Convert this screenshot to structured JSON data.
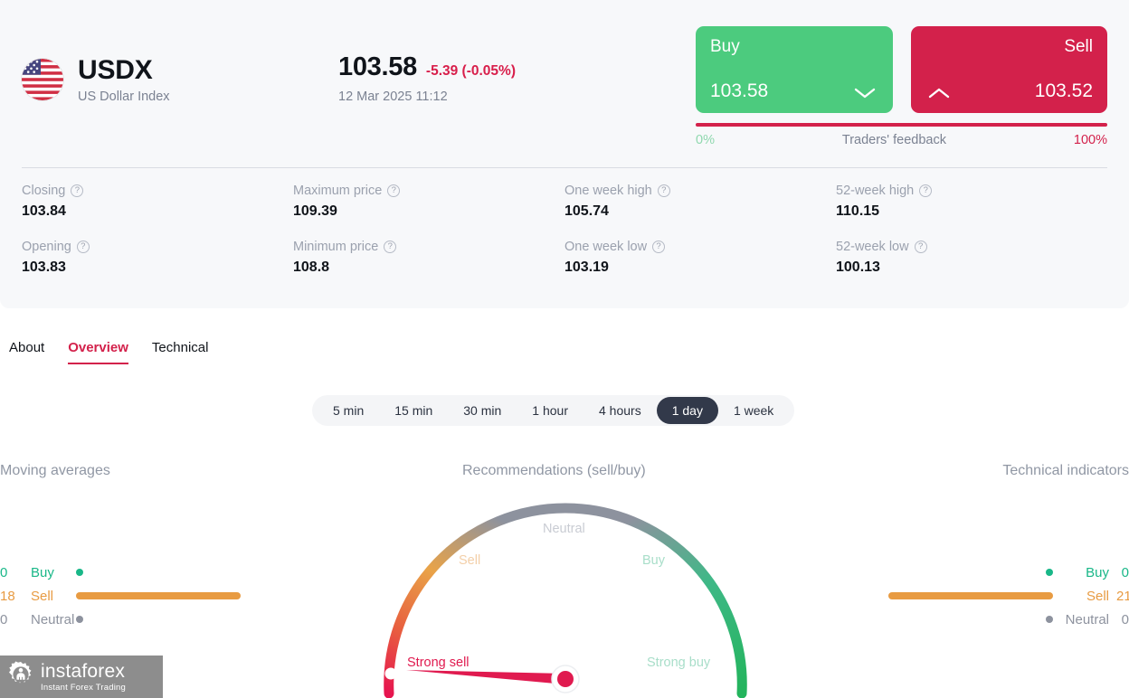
{
  "symbol": {
    "ticker": "USDX",
    "name": "US Dollar Index",
    "flag_icon": "us-flag-icon"
  },
  "quote": {
    "price": "103.58",
    "change": "-5.39 (-0.05%)",
    "timestamp": "12 Mar 2025 11:12",
    "change_color": "#d81e4a"
  },
  "trade": {
    "buy_label": "Buy",
    "buy_price": "103.58",
    "buy_color": "#4ccb7e",
    "sell_label": "Sell",
    "sell_price": "103.52",
    "sell_color": "#d3214b",
    "feedback_label": "Traders' feedback",
    "feedback_buy_pct": "0%",
    "feedback_sell_pct": "100%"
  },
  "stats": [
    {
      "label": "Closing",
      "value": "103.84"
    },
    {
      "label": "Maximum price",
      "value": "109.39"
    },
    {
      "label": "One week high",
      "value": "105.74"
    },
    {
      "label": "52-week high",
      "value": "110.15"
    },
    {
      "label": "Opening",
      "value": "103.83"
    },
    {
      "label": "Minimum price",
      "value": "108.8"
    },
    {
      "label": "One week low",
      "value": "103.19"
    },
    {
      "label": "52-week low",
      "value": "100.13"
    }
  ],
  "tabs": [
    {
      "label": "About",
      "active": false
    },
    {
      "label": "Overview",
      "active": true
    },
    {
      "label": "Technical",
      "active": false
    }
  ],
  "timeframes": [
    {
      "label": "5 min",
      "active": false
    },
    {
      "label": "15 min",
      "active": false
    },
    {
      "label": "30 min",
      "active": false
    },
    {
      "label": "1 hour",
      "active": false
    },
    {
      "label": "4 hours",
      "active": false
    },
    {
      "label": "1 day",
      "active": true
    },
    {
      "label": "1 week",
      "active": false
    }
  ],
  "moving_averages": {
    "title": "Moving averages",
    "rows": [
      {
        "label": "Buy",
        "count": "0",
        "color": "#19b788"
      },
      {
        "label": "Sell",
        "count": "18",
        "color": "#e89b42"
      },
      {
        "label": "Neutral",
        "count": "0",
        "color": "#8d929e"
      }
    ]
  },
  "technical_indicators": {
    "title": "Technical indicators",
    "rows": [
      {
        "label": "Buy",
        "count": "0",
        "color": "#19b788"
      },
      {
        "label": "Sell",
        "count": "21",
        "color": "#e89b42"
      },
      {
        "label": "Neutral",
        "count": "0",
        "color": "#8d929e"
      }
    ]
  },
  "recommendations": {
    "title": "Recommendations (sell/buy)",
    "verdict": "Strong sell",
    "labels": {
      "strong_sell": "Strong sell",
      "sell": "Sell",
      "neutral": "Neutral",
      "buy": "Buy",
      "strong_buy": "Strong buy"
    }
  },
  "chart_data": {
    "type": "bar",
    "title": "Recommendations (sell/buy)",
    "gauge": {
      "type": "gauge",
      "scale": [
        "Strong sell",
        "Sell",
        "Neutral",
        "Buy",
        "Strong buy"
      ],
      "needle_position": "Strong sell",
      "needle_angle_deg": 175,
      "arc_colors": [
        "#e31b54",
        "#e89b42",
        "#8d929e",
        "#3ab77d",
        "#20b55f"
      ]
    },
    "categories": [
      "Buy",
      "Sell",
      "Neutral"
    ],
    "series": [
      {
        "name": "Moving averages",
        "values": [
          0,
          18,
          0
        ]
      },
      {
        "name": "Technical indicators",
        "values": [
          0,
          21,
          0
        ]
      }
    ],
    "colors": [
      "#19b788",
      "#e89b42",
      "#8d929e"
    ],
    "xlabel": "",
    "ylabel": "",
    "ylim": [
      0,
      21
    ]
  },
  "watermark": {
    "name": "instaforex",
    "tagline": "Instant Forex Trading"
  }
}
